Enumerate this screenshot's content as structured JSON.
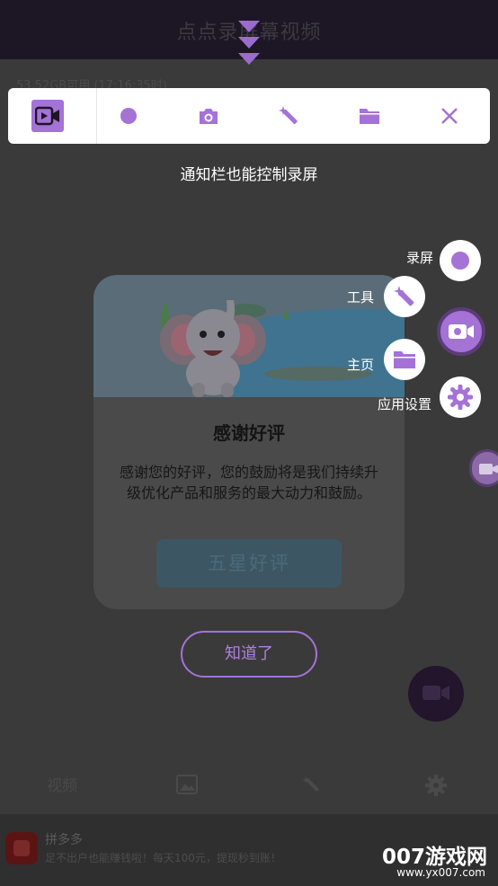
{
  "app": {
    "title": "点点录屏幕视频",
    "storage_text": "53.52GB可用 (17:16:35时)"
  },
  "toolbar": {
    "items": [
      {
        "icon": "video-camera-icon",
        "active": true
      },
      {
        "icon": "record-dot-icon"
      },
      {
        "icon": "camera-icon"
      },
      {
        "icon": "magic-wand-icon"
      },
      {
        "icon": "folder-icon"
      },
      {
        "icon": "close-icon"
      }
    ]
  },
  "hint": "通知栏也能控制录屏",
  "dialog": {
    "title": "感谢好评",
    "body": "感谢您的好评，您的鼓励将是我们持续升级优化产品和服务的最大动力和鼓励。",
    "rate_button": "五星好评"
  },
  "got_it_button": "知道了",
  "float_menu": {
    "record_label": "录屏",
    "tools_label": "工具",
    "home_label": "主页",
    "settings_label": "应用设置"
  },
  "tabbar": {
    "video_label": "视频"
  },
  "ad": {
    "name": "拼多多",
    "desc": "足不出户也能赚钱啦！每天100元，提现秒到账！"
  },
  "watermark": {
    "line1": "007游戏网",
    "line2": "www.yx007.com"
  },
  "colors": {
    "accent": "#a572d6",
    "overlay_bg": "#3a3a3a",
    "toolbar_bg": "#ffffff"
  }
}
